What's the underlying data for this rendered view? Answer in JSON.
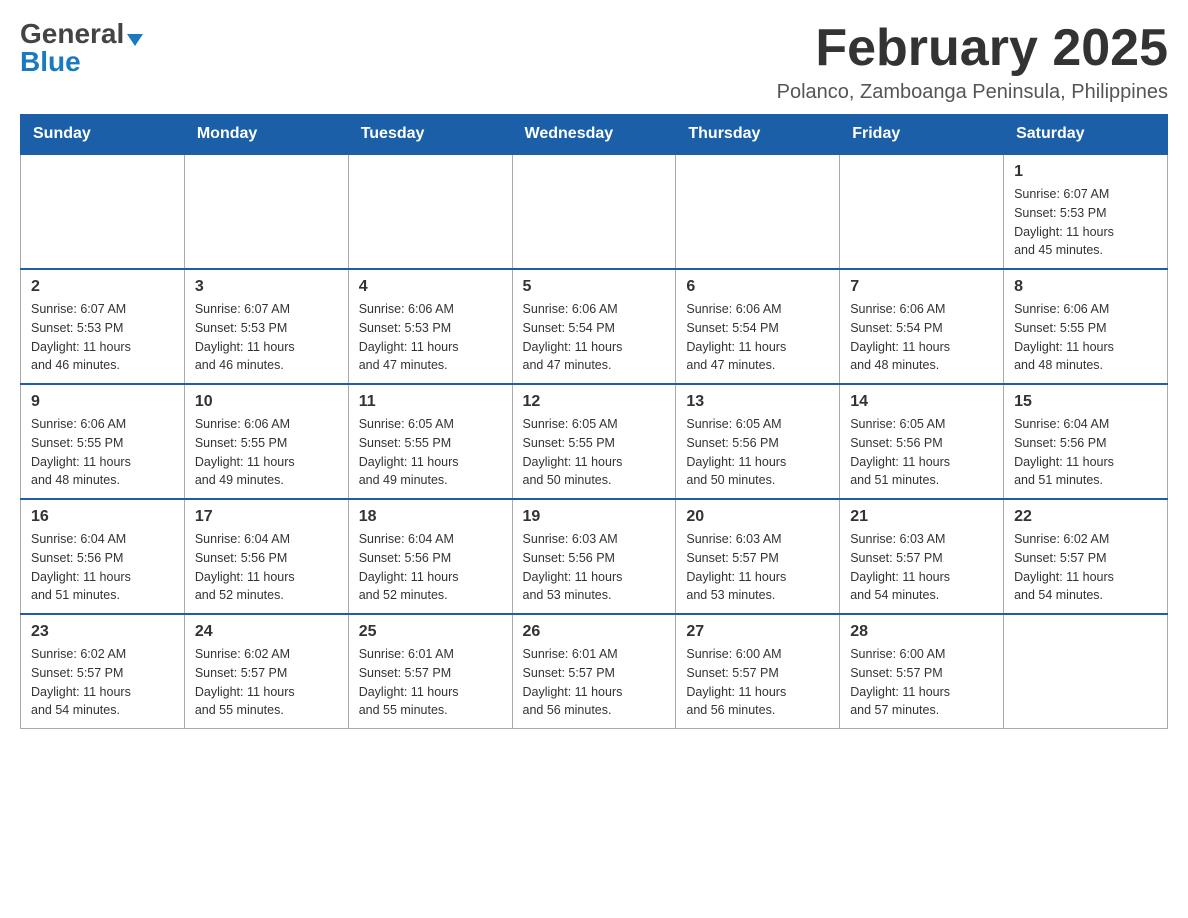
{
  "header": {
    "logo_line1": "General",
    "logo_line2": "Blue",
    "month_title": "February 2025",
    "location": "Polanco, Zamboanga Peninsula, Philippines"
  },
  "calendar": {
    "days_of_week": [
      "Sunday",
      "Monday",
      "Tuesday",
      "Wednesday",
      "Thursday",
      "Friday",
      "Saturday"
    ],
    "weeks": [
      {
        "days": [
          {
            "number": "",
            "info": ""
          },
          {
            "number": "",
            "info": ""
          },
          {
            "number": "",
            "info": ""
          },
          {
            "number": "",
            "info": ""
          },
          {
            "number": "",
            "info": ""
          },
          {
            "number": "",
            "info": ""
          },
          {
            "number": "1",
            "info": "Sunrise: 6:07 AM\nSunset: 5:53 PM\nDaylight: 11 hours\nand 45 minutes."
          }
        ]
      },
      {
        "days": [
          {
            "number": "2",
            "info": "Sunrise: 6:07 AM\nSunset: 5:53 PM\nDaylight: 11 hours\nand 46 minutes."
          },
          {
            "number": "3",
            "info": "Sunrise: 6:07 AM\nSunset: 5:53 PM\nDaylight: 11 hours\nand 46 minutes."
          },
          {
            "number": "4",
            "info": "Sunrise: 6:06 AM\nSunset: 5:53 PM\nDaylight: 11 hours\nand 47 minutes."
          },
          {
            "number": "5",
            "info": "Sunrise: 6:06 AM\nSunset: 5:54 PM\nDaylight: 11 hours\nand 47 minutes."
          },
          {
            "number": "6",
            "info": "Sunrise: 6:06 AM\nSunset: 5:54 PM\nDaylight: 11 hours\nand 47 minutes."
          },
          {
            "number": "7",
            "info": "Sunrise: 6:06 AM\nSunset: 5:54 PM\nDaylight: 11 hours\nand 48 minutes."
          },
          {
            "number": "8",
            "info": "Sunrise: 6:06 AM\nSunset: 5:55 PM\nDaylight: 11 hours\nand 48 minutes."
          }
        ]
      },
      {
        "days": [
          {
            "number": "9",
            "info": "Sunrise: 6:06 AM\nSunset: 5:55 PM\nDaylight: 11 hours\nand 48 minutes."
          },
          {
            "number": "10",
            "info": "Sunrise: 6:06 AM\nSunset: 5:55 PM\nDaylight: 11 hours\nand 49 minutes."
          },
          {
            "number": "11",
            "info": "Sunrise: 6:05 AM\nSunset: 5:55 PM\nDaylight: 11 hours\nand 49 minutes."
          },
          {
            "number": "12",
            "info": "Sunrise: 6:05 AM\nSunset: 5:55 PM\nDaylight: 11 hours\nand 50 minutes."
          },
          {
            "number": "13",
            "info": "Sunrise: 6:05 AM\nSunset: 5:56 PM\nDaylight: 11 hours\nand 50 minutes."
          },
          {
            "number": "14",
            "info": "Sunrise: 6:05 AM\nSunset: 5:56 PM\nDaylight: 11 hours\nand 51 minutes."
          },
          {
            "number": "15",
            "info": "Sunrise: 6:04 AM\nSunset: 5:56 PM\nDaylight: 11 hours\nand 51 minutes."
          }
        ]
      },
      {
        "days": [
          {
            "number": "16",
            "info": "Sunrise: 6:04 AM\nSunset: 5:56 PM\nDaylight: 11 hours\nand 51 minutes."
          },
          {
            "number": "17",
            "info": "Sunrise: 6:04 AM\nSunset: 5:56 PM\nDaylight: 11 hours\nand 52 minutes."
          },
          {
            "number": "18",
            "info": "Sunrise: 6:04 AM\nSunset: 5:56 PM\nDaylight: 11 hours\nand 52 minutes."
          },
          {
            "number": "19",
            "info": "Sunrise: 6:03 AM\nSunset: 5:56 PM\nDaylight: 11 hours\nand 53 minutes."
          },
          {
            "number": "20",
            "info": "Sunrise: 6:03 AM\nSunset: 5:57 PM\nDaylight: 11 hours\nand 53 minutes."
          },
          {
            "number": "21",
            "info": "Sunrise: 6:03 AM\nSunset: 5:57 PM\nDaylight: 11 hours\nand 54 minutes."
          },
          {
            "number": "22",
            "info": "Sunrise: 6:02 AM\nSunset: 5:57 PM\nDaylight: 11 hours\nand 54 minutes."
          }
        ]
      },
      {
        "days": [
          {
            "number": "23",
            "info": "Sunrise: 6:02 AM\nSunset: 5:57 PM\nDaylight: 11 hours\nand 54 minutes."
          },
          {
            "number": "24",
            "info": "Sunrise: 6:02 AM\nSunset: 5:57 PM\nDaylight: 11 hours\nand 55 minutes."
          },
          {
            "number": "25",
            "info": "Sunrise: 6:01 AM\nSunset: 5:57 PM\nDaylight: 11 hours\nand 55 minutes."
          },
          {
            "number": "26",
            "info": "Sunrise: 6:01 AM\nSunset: 5:57 PM\nDaylight: 11 hours\nand 56 minutes."
          },
          {
            "number": "27",
            "info": "Sunrise: 6:00 AM\nSunset: 5:57 PM\nDaylight: 11 hours\nand 56 minutes."
          },
          {
            "number": "28",
            "info": "Sunrise: 6:00 AM\nSunset: 5:57 PM\nDaylight: 11 hours\nand 57 minutes."
          },
          {
            "number": "",
            "info": ""
          }
        ]
      }
    ]
  }
}
